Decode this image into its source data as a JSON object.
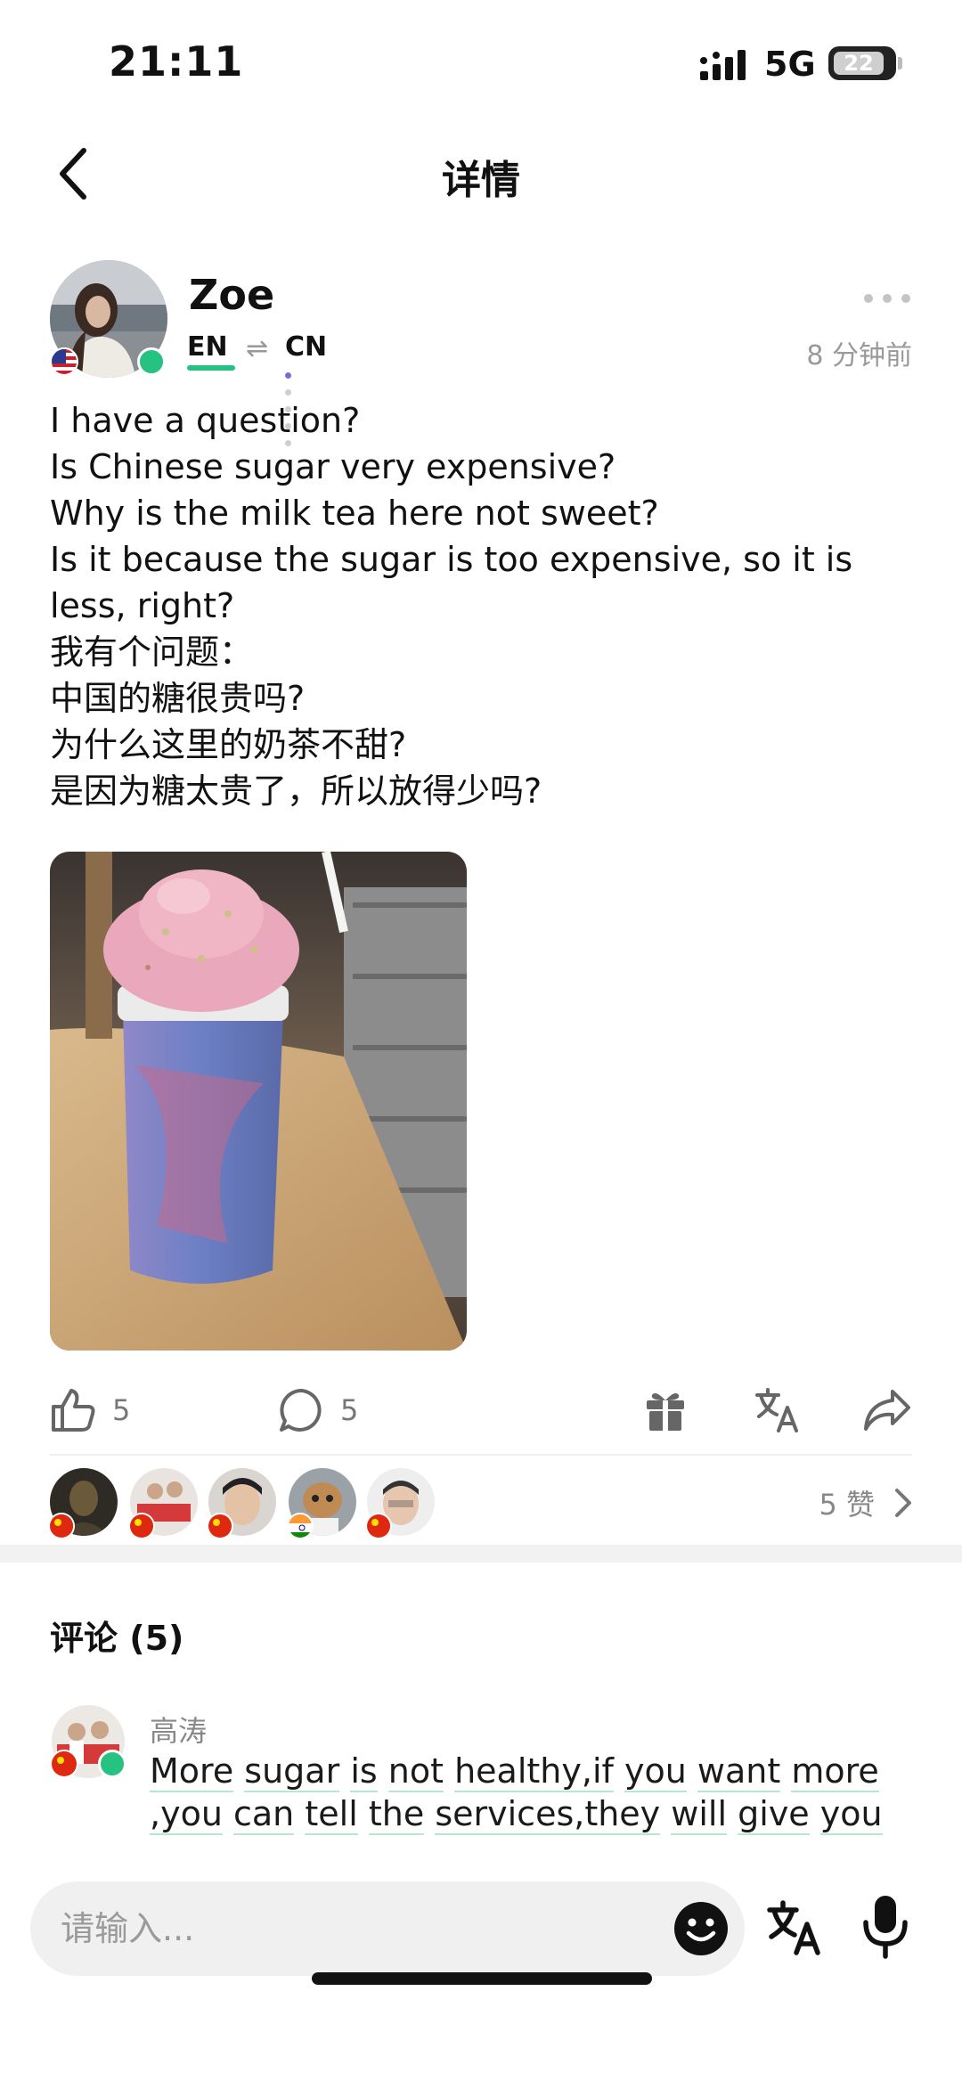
{
  "status_bar": {
    "time": "21:11",
    "network": "5G",
    "battery": "22"
  },
  "nav": {
    "title": "详情"
  },
  "post": {
    "author": "Zoe",
    "lang_from": "EN",
    "lang_to": "CN",
    "time_ago": "8 分钟前",
    "lines": [
      "I have a question?",
      "Is Chinese sugar very expensive?",
      "Why is the milk tea here not sweet?",
      "Is it because the sugar is too expensive, so it is less, right?",
      "我有个问题：",
      "中国的糖很贵吗?",
      "为什么这里的奶茶不甜?",
      "是因为糖太贵了，所以放得少吗?"
    ]
  },
  "actions": {
    "likes": "5",
    "comments": "5"
  },
  "likers": {
    "total": "5 赞"
  },
  "comments": {
    "title": "评论 (5)",
    "items": [
      {
        "author": "高涛",
        "text": "More sugar is not healthy,if you want more ,you can tell the services,they will give you"
      }
    ]
  },
  "input": {
    "placeholder": "请输入..."
  },
  "colors": {
    "accent_green": "#26c281",
    "text_gray": "#888888",
    "divider": "#efefef"
  }
}
